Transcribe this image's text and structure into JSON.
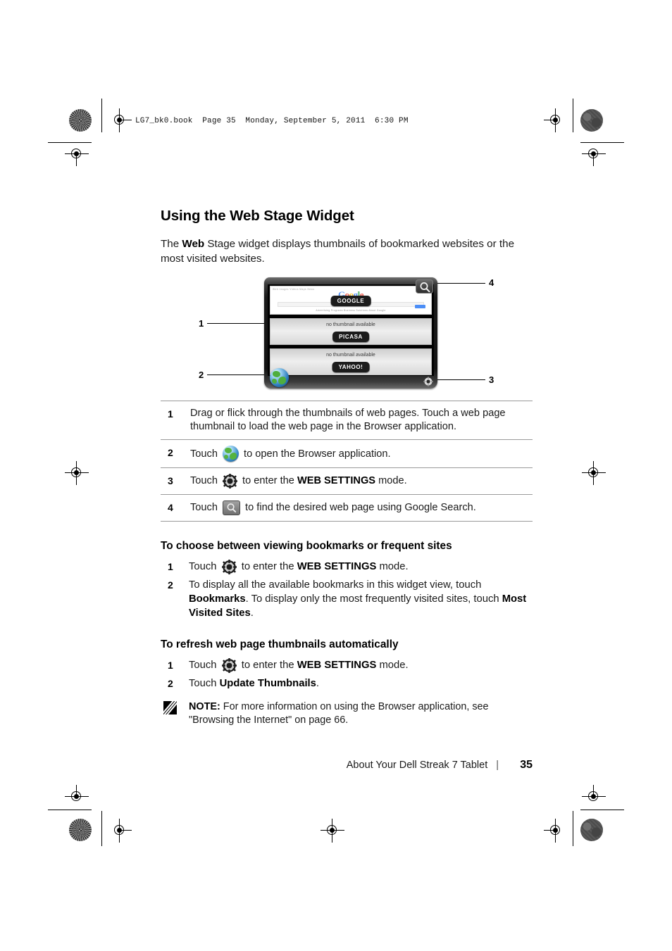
{
  "page": {
    "header_line": "LG7_bk0.book  Page 35  Monday, September 5, 2011  6:30 PM",
    "section_title": "Using the Web Stage Widget",
    "intro_prefix": "The ",
    "intro_bold": "Web",
    "intro_suffix": " Stage widget displays thumbnails of bookmarked websites or the most visited websites."
  },
  "figure": {
    "callouts": [
      "1",
      "2",
      "3",
      "4"
    ],
    "widget": {
      "google_thumb": {
        "logo_letters": [
          "G",
          "o",
          "o",
          "g",
          "l",
          "e"
        ],
        "topbar_text": "Web Images Videos Maps News",
        "footer_links": "Advertising Programs  Business Solutions  About Google",
        "pill": "GOOGLE"
      },
      "picasa_thumb": {
        "no_thumbnail_text": "no thumbnail available",
        "pill": "PICASA"
      },
      "yahoo_thumb": {
        "no_thumbnail_text": "no thumbnail available",
        "pill": "YAHOO!"
      },
      "search_button_icon": "magnifier-icon",
      "browser_button_icon": "globe-icon",
      "settings_button_icon": "gear-icon"
    }
  },
  "legend_table": {
    "rows": [
      {
        "num": "1",
        "text": "Drag or flick through the thumbnails of web pages. Touch a web page thumbnail to load the web page in the Browser application.",
        "icon": null
      },
      {
        "num": "2",
        "pre": "Touch ",
        "icon": "globe-icon",
        "post": " to open the Browser application.",
        "bold": ""
      },
      {
        "num": "3",
        "pre": "Touch ",
        "icon": "gear-icon",
        "post_a": " to enter the ",
        "bold": "WEB SETTINGS",
        "post_b": " mode."
      },
      {
        "num": "4",
        "pre": "Touch ",
        "icon": "search-icon",
        "post": " to find the desired web page using Google Search."
      }
    ]
  },
  "procedures": [
    {
      "title": "To choose between viewing bookmarks or frequent sites",
      "steps": [
        {
          "num": "1",
          "pre": "Touch ",
          "icon": "gear-icon",
          "post_a": " to enter the ",
          "bold": "WEB SETTINGS",
          "post_b": " mode."
        },
        {
          "num": "2",
          "pre": "To display all the available bookmarks in this widget view, touch ",
          "bold_a": "Bookmarks",
          "mid": ". To display only the most frequently visited sites, touch ",
          "bold_b": "Most Visited Sites",
          "post": "."
        }
      ]
    },
    {
      "title": "To refresh web page thumbnails automatically",
      "steps": [
        {
          "num": "1",
          "pre": "Touch ",
          "icon": "gear-icon",
          "post_a": " to enter the ",
          "bold": "WEB SETTINGS",
          "post_b": " mode."
        },
        {
          "num": "2",
          "pre": "Touch ",
          "bold_a": "Update Thumbnails",
          "post": "."
        }
      ]
    }
  ],
  "note": {
    "label": "NOTE:",
    "text": " For more information on using the Browser application, see \"Browsing the Internet\" on page 66."
  },
  "footer": {
    "chapter": "About Your Dell Streak 7 Tablet",
    "separator": "|",
    "page_number": "35"
  }
}
